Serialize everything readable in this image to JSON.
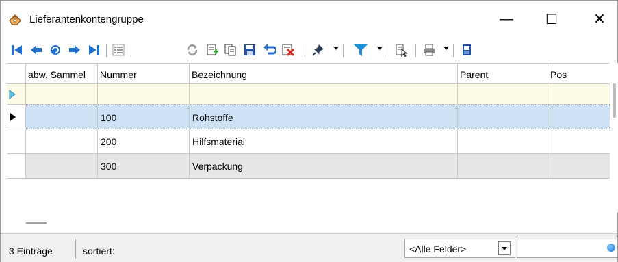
{
  "window": {
    "title": "Lieferantenkontengruppe",
    "minimize_glyph": "—",
    "maximize_glyph": "☐",
    "close_glyph": "✕"
  },
  "toolbar": {
    "icons": [
      "first-record-icon",
      "previous-record-icon",
      "refresh-nav-icon",
      "next-record-icon",
      "last-record-icon",
      "list-view-icon",
      "reload-icon",
      "new-record-icon",
      "copy-record-icon",
      "save-icon",
      "undo-icon",
      "delete-icon",
      "pin-icon",
      "filter-icon",
      "column-chooser-icon",
      "print-icon",
      "exit-icon"
    ],
    "accent": "#1f6fd1"
  },
  "grid": {
    "columns": [
      "abw. Sammel",
      "Nummer",
      "Bezeichnung",
      "Parent",
      "Pos"
    ],
    "rows": [
      {
        "abw": "",
        "nummer": "100",
        "bezeichnung": "Rohstoffe",
        "parent": "",
        "pos": ""
      },
      {
        "abw": "",
        "nummer": "200",
        "bezeichnung": "Hilfsmaterial",
        "parent": "",
        "pos": ""
      },
      {
        "abw": "",
        "nummer": "300",
        "bezeichnung": "Verpackung",
        "parent": "",
        "pos": ""
      }
    ]
  },
  "statusbar": {
    "count": "3 Einträge",
    "sorted": "sortiert:",
    "field_select": "<Alle Felder>",
    "search_value": ""
  }
}
